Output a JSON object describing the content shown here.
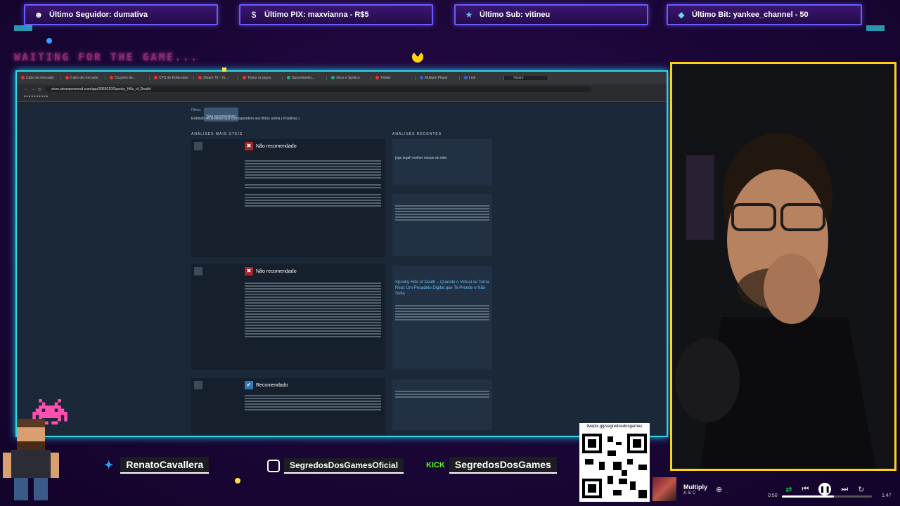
{
  "overlay": {
    "top_bars": [
      {
        "icon": "user-icon",
        "text": "Último Seguidor: dumativa"
      },
      {
        "icon": "dollar-icon",
        "text": "Último PIX: maxvianna - R$5"
      },
      {
        "icon": "star-icon",
        "text": "Último Sub: vitineu"
      },
      {
        "icon": "gem-icon",
        "text": "Último Bit: yankee_channel - 50"
      }
    ],
    "waiting_text": "WAITING FOR THE GAME...",
    "accent": "#2fd6e6",
    "cam_border": "#ffd21a"
  },
  "browser": {
    "tabs": [
      "Cabo de mercado",
      "Cabo de mercado",
      "Cruzeiro de...",
      "CPS de Rotterdam",
      "Steam 76 - Yo...",
      "Todos os jogos",
      "Spoonfeeder...",
      "Xbox e Spotico",
      "Twitter",
      "Multiple Player",
      "Link",
      "Steam"
    ],
    "url": "store.steampowered.com/app/3962010/Spooky_Hills_of_Death/",
    "page": {
      "filter_label": "Filtros",
      "filter_value": "Nao recomendado",
      "summary": "Exibindo 46 análises que correspondem aos filtros acima ( Positivas )",
      "reviews_heading": "ANÁLISES MAIS ÚTEIS",
      "recent_heading": "ANÁLISES RECENTES",
      "reviews": [
        {
          "verdict": "Não recomendado"
        },
        {
          "verdict": "Não recomendado"
        },
        {
          "verdict": "Recomendado"
        }
      ],
      "recent_snippet": "jogo legal! melhor ensaio de ódio",
      "recent_headline": "Spooky Hills of Death – Quando o Virtual se Torna Real: Um Pesadelo Digital que Te Prende e Não Solta"
    }
  },
  "socials": {
    "twitter": "RenatoCavallera",
    "instagram": "SegredosDosGamesOficial",
    "kick": "SegredosDosGames",
    "kick_logo": "KICK"
  },
  "qr_caption": "livepix.gg/segredosdosgames",
  "player": {
    "title": "Multiply",
    "artist": "A & C",
    "elapsed": "0:50",
    "duration": "1:47",
    "progress": 0.58
  }
}
